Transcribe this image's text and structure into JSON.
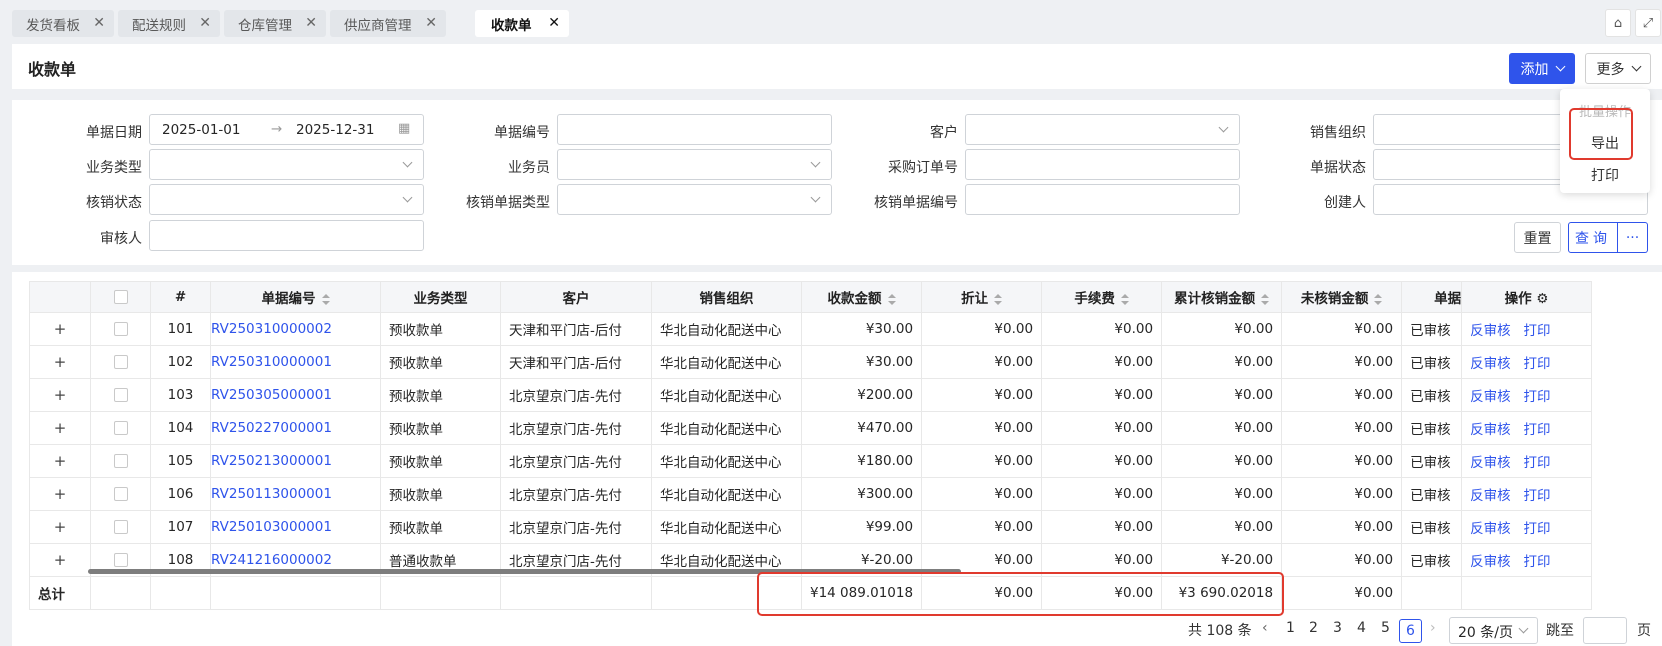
{
  "tabs": [
    {
      "label": "发货看板"
    },
    {
      "label": "配送规则"
    },
    {
      "label": "仓库管理"
    },
    {
      "label": "供应商管理"
    },
    {
      "label": "收款单"
    }
  ],
  "header": {
    "title": "收款单",
    "add_label": "添加",
    "more_label": "更多"
  },
  "more_menu": {
    "group_label": "批量操作",
    "items": [
      "导出",
      "打印"
    ]
  },
  "filters": {
    "date_label": "单据日期",
    "date_start": "2025-01-01",
    "date_sep": "→",
    "date_end": "2025-12-31",
    "doc_no": "单据编号",
    "customer": "客户",
    "sales_org": "销售组织",
    "biz_type": "业务类型",
    "salesman": "业务员",
    "po_no": "采购订单号",
    "doc_status": "单据状态",
    "wo_status": "核销状态",
    "wo_doc_type": "核销单据类型",
    "wo_doc_no": "核销单据编号",
    "creator": "创建人",
    "reviewer": "审核人",
    "reset_label": "重置",
    "query_label": "查询",
    "query_more": "···"
  },
  "table": {
    "headers": [
      "#",
      "单据编号",
      "业务类型",
      "客户",
      "销售组织",
      "收款金额",
      "折让",
      "手续费",
      "累计核销金额",
      "未核销金额",
      "单据",
      "操作"
    ],
    "rows": [
      {
        "no": "101",
        "doc": "RV250310000002",
        "type": "预收款单",
        "cust": "天津和平门店-后付",
        "org": "华北自动化配送中心",
        "amt": "¥30.00",
        "disc": "¥0.00",
        "fee": "¥0.00",
        "wo": "¥0.00",
        "unwo": "¥0.00",
        "status": "已审核",
        "a1": "反审核",
        "a2": "打印"
      },
      {
        "no": "102",
        "doc": "RV250310000001",
        "type": "预收款单",
        "cust": "天津和平门店-后付",
        "org": "华北自动化配送中心",
        "amt": "¥30.00",
        "disc": "¥0.00",
        "fee": "¥0.00",
        "wo": "¥0.00",
        "unwo": "¥0.00",
        "status": "已审核",
        "a1": "反审核",
        "a2": "打印"
      },
      {
        "no": "103",
        "doc": "RV250305000001",
        "type": "预收款单",
        "cust": "北京望京门店-先付",
        "org": "华北自动化配送中心",
        "amt": "¥200.00",
        "disc": "¥0.00",
        "fee": "¥0.00",
        "wo": "¥0.00",
        "unwo": "¥0.00",
        "status": "已审核",
        "a1": "反审核",
        "a2": "打印"
      },
      {
        "no": "104",
        "doc": "RV250227000001",
        "type": "预收款单",
        "cust": "北京望京门店-先付",
        "org": "华北自动化配送中心",
        "amt": "¥470.00",
        "disc": "¥0.00",
        "fee": "¥0.00",
        "wo": "¥0.00",
        "unwo": "¥0.00",
        "status": "已审核",
        "a1": "反审核",
        "a2": "打印"
      },
      {
        "no": "105",
        "doc": "RV250213000001",
        "type": "预收款单",
        "cust": "北京望京门店-先付",
        "org": "华北自动化配送中心",
        "amt": "¥180.00",
        "disc": "¥0.00",
        "fee": "¥0.00",
        "wo": "¥0.00",
        "unwo": "¥0.00",
        "status": "已审核",
        "a1": "反审核",
        "a2": "打印"
      },
      {
        "no": "106",
        "doc": "RV250113000001",
        "type": "预收款单",
        "cust": "北京望京门店-先付",
        "org": "华北自动化配送中心",
        "amt": "¥300.00",
        "disc": "¥0.00",
        "fee": "¥0.00",
        "wo": "¥0.00",
        "unwo": "¥0.00",
        "status": "已审核",
        "a1": "反审核",
        "a2": "打印"
      },
      {
        "no": "107",
        "doc": "RV250103000001",
        "type": "预收款单",
        "cust": "北京望京门店-先付",
        "org": "华北自动化配送中心",
        "amt": "¥99.00",
        "disc": "¥0.00",
        "fee": "¥0.00",
        "wo": "¥0.00",
        "unwo": "¥0.00",
        "status": "已审核",
        "a1": "反审核",
        "a2": "打印"
      },
      {
        "no": "108",
        "doc": "RV241216000002",
        "type": "普通收款单",
        "cust": "北京望京门店-先付",
        "org": "华北自动化配送中心",
        "amt": "¥-20.00",
        "disc": "¥0.00",
        "fee": "¥0.00",
        "wo": "¥-20.00",
        "unwo": "¥0.00",
        "status": "已审核",
        "a1": "反审核",
        "a2": "打印"
      }
    ],
    "total": {
      "label": "总计",
      "amt": "¥14 089.01018",
      "disc": "¥0.00",
      "fee": "¥0.00",
      "wo": "¥3 690.02018",
      "unwo": "¥0.00"
    }
  },
  "pagination": {
    "total_text": "共 108 条",
    "pages": [
      "1",
      "2",
      "3",
      "4",
      "5",
      "6"
    ],
    "current": "6",
    "page_size": "20 条/页",
    "jump_label": "跳至",
    "page_suffix": "页"
  },
  "colors": {
    "accent": "#2f54eb",
    "highlight": "#e03a2e"
  }
}
